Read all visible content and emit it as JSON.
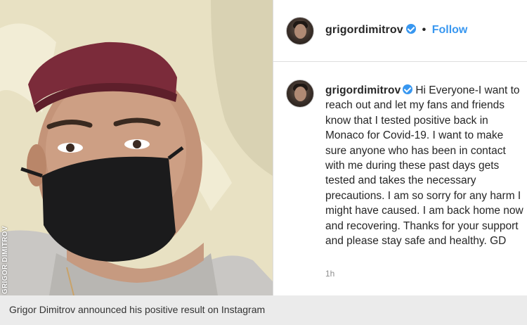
{
  "photo": {
    "credit": "GRIGOR DIMITROV",
    "description_icon": "photo-image"
  },
  "post": {
    "header": {
      "username": "grigordimitrov",
      "separator": "•",
      "follow_label": "Follow"
    },
    "caption": {
      "username": "grigordimitrov",
      "text": "Hi Everyone-I want to reach out and let my fans and friends know that I tested positive back in Monaco for Covid-19. I want to make sure anyone who has been in contact with me during these past days gets tested and takes the necessary precautions. I am so sorry for any harm I might have caused. I am back home now and recovering. Thanks for your support and please stay safe and healthy. GD"
    },
    "timestamp": "1h"
  },
  "figure_caption": "Grigor Dimitrov announced his positive result on Instagram",
  "colors": {
    "instagram_blue": "#3897f0",
    "text": "#262626",
    "muted": "#8e8e8e",
    "caption_bar": "#ebebeb"
  }
}
